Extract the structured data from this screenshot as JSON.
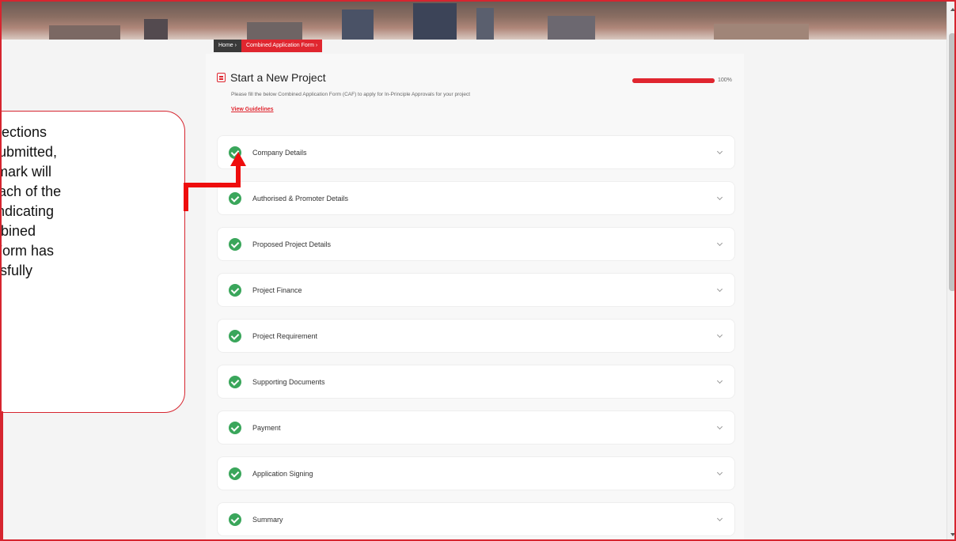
{
  "breadcrumb": {
    "home": "Home  ›",
    "current": "Combined Application Form  ›"
  },
  "header": {
    "title": "Start a New Project",
    "subtitle": "Please fill the below Combined Application Form (CAF) to apply for In-Principle Approvals for your project",
    "guidelines_link": "View Guidelines"
  },
  "progress": {
    "value": 1.0,
    "label": "100%"
  },
  "sections": [
    {
      "label": "Company Details",
      "status": "complete"
    },
    {
      "label": "Authorised & Promoter Details",
      "status": "complete"
    },
    {
      "label": "Proposed Project Details",
      "status": "complete"
    },
    {
      "label": "Project Finance",
      "status": "complete"
    },
    {
      "label": "Project Requirement",
      "status": "complete"
    },
    {
      "label": "Supporting Documents",
      "status": "complete"
    },
    {
      "label": "Payment",
      "status": "complete"
    },
    {
      "label": "Application Signing",
      "status": "complete"
    },
    {
      "label": "Summary",
      "status": "complete"
    }
  ],
  "callout": {
    "text": "the sections\nl & submitted,\ntick mark will\non each of the\nns, indicating\nCombined\nion Form has\nccessfully\ned"
  },
  "colors": {
    "accent": "#e0262f",
    "check": "#3aa65b",
    "annotation": "#ee0d0d"
  },
  "icons": {
    "section_status": "check-circle-icon",
    "section_toggle": "chevron-down-icon",
    "title": "document-icon"
  }
}
